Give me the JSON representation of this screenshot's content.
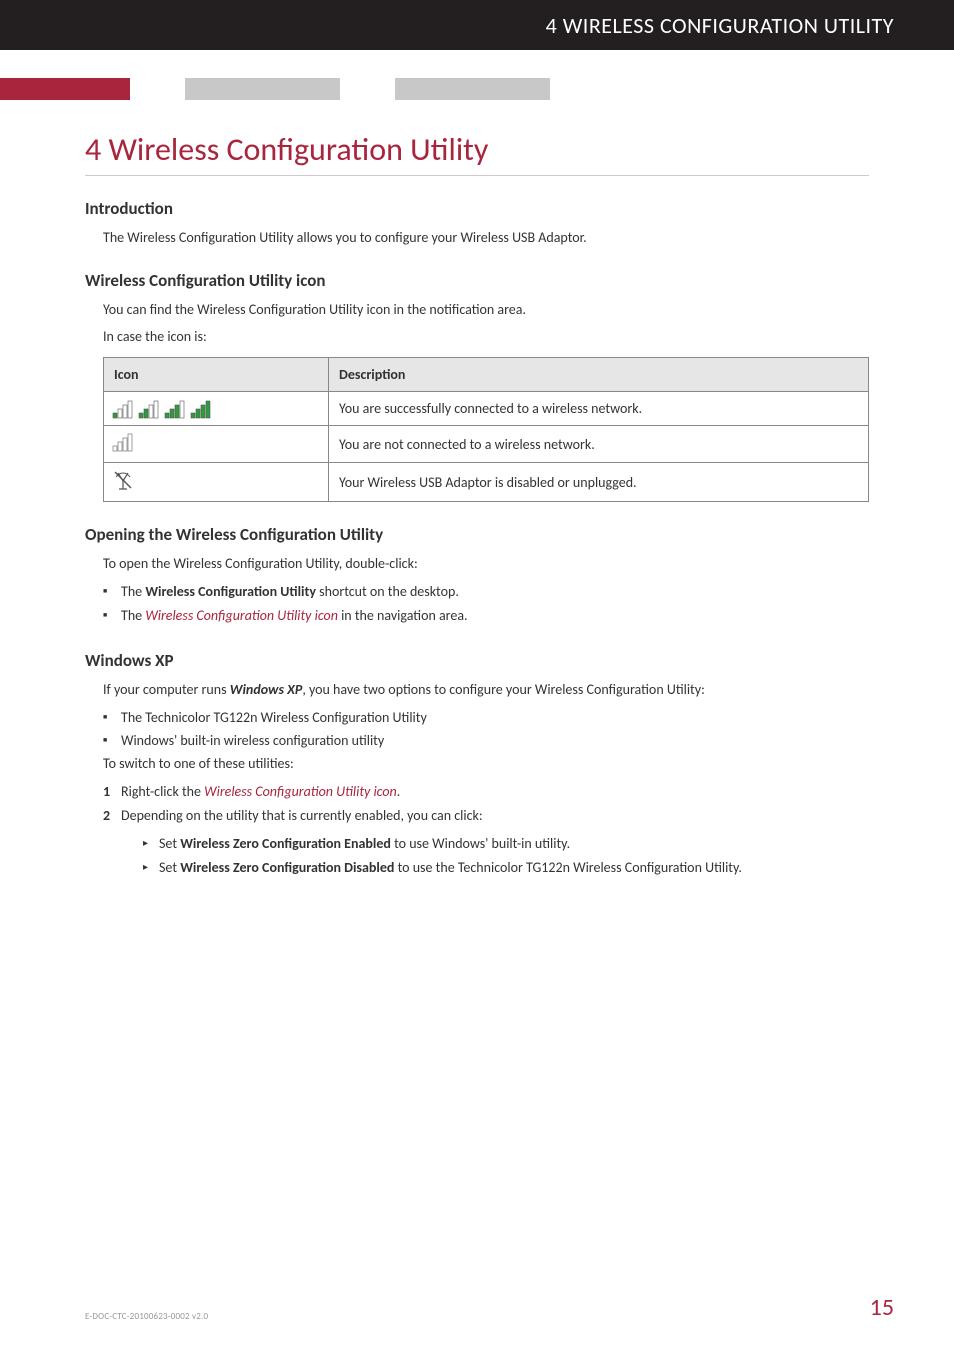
{
  "header": {
    "running_title": "4 WIRELESS CONFIGURATION UTILITY"
  },
  "chapter": {
    "number": "4",
    "title": "Wireless Configuration Utility",
    "full": "4  Wireless Configuration Utility"
  },
  "intro": {
    "heading": "Introduction",
    "text": "The Wireless Configuration Utility allows you to configure your Wireless USB Adaptor."
  },
  "icon_section": {
    "heading": "Wireless Configuration Utility icon",
    "text1": "You can find the Wireless Configuration Utility icon in the notification area.",
    "text2": "In case the icon is:",
    "table": {
      "col1": "Icon",
      "col2": "Description",
      "rows": [
        {
          "icon_name": "signal-strength-bars-green-icons",
          "desc": "You are successfully connected to a wireless network."
        },
        {
          "icon_name": "signal-bars-grey-icon",
          "desc": "You are not connected to a wireless network."
        },
        {
          "icon_name": "antenna-crossed-icon",
          "desc": "Your Wireless USB Adaptor is disabled or unplugged."
        }
      ]
    }
  },
  "opening": {
    "heading": "Opening the Wireless Configuration Utility",
    "text": "To open the Wireless Configuration Utility, double-click:",
    "items": [
      {
        "pre": "The ",
        "bold": "Wireless Configuration Utility",
        "post": " shortcut on the desktop."
      },
      {
        "pre": "The ",
        "link": "Wireless Configuration Utility icon",
        "post": " in the navigation area."
      }
    ]
  },
  "windows_xp": {
    "heading": "Windows XP",
    "intro_pre": "If your computer runs ",
    "intro_bold": "Windows XP",
    "intro_post": ", you have two options to configure your Wireless Configuration Utility:",
    "options": [
      "The Technicolor TG122n Wireless Configuration Utility",
      "Windows' built-in wireless configuration utility"
    ],
    "switch_text": "To switch to one of these utilities:",
    "steps": [
      {
        "n": "1",
        "pre": "Right-click the ",
        "link": "Wireless Configuration Utility icon",
        "post": "."
      },
      {
        "n": "2",
        "text": "Depending on the utility that is currently enabled, you can click:",
        "sub": [
          {
            "pre": "Set ",
            "bold": "Wireless Zero Configuration Enabled",
            "post": " to use Windows' built-in utility."
          },
          {
            "pre": "Set ",
            "bold": "Wireless Zero Configuration Disabled",
            "post": " to use the Technicolor TG122n Wireless Configuration Utility."
          }
        ]
      }
    ]
  },
  "footer": {
    "doc_code": "E-DOC-CTC-20100623-0002 v2.0",
    "page": "15"
  }
}
